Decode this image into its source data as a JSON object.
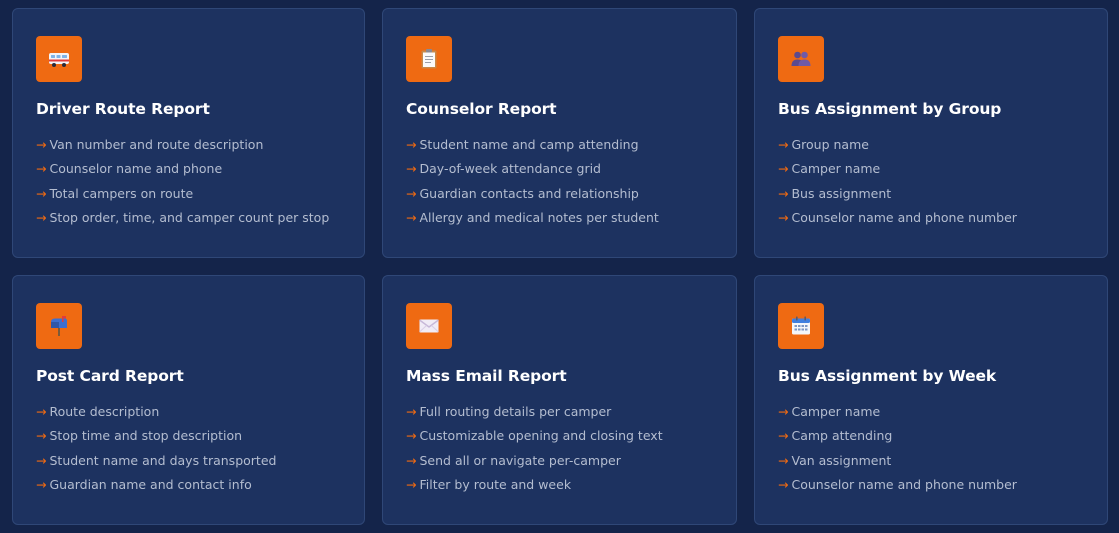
{
  "colors": {
    "background": "#14244a",
    "card": "#1d3260",
    "accent": "#ef6a12",
    "title": "#ffffff",
    "text": "#b4bdd0"
  },
  "arrow": "→",
  "cards": [
    {
      "icon": "van-icon",
      "title": "Driver Route Report",
      "features": [
        "Van number and route description",
        "Counselor name and phone",
        "Total campers on route",
        "Stop order, time, and camper count per stop"
      ]
    },
    {
      "icon": "clipboard-icon",
      "title": "Counselor Report",
      "features": [
        "Student name and camp attending",
        "Day-of-week attendance grid",
        "Guardian contacts and relationship",
        "Allergy and medical notes per student"
      ]
    },
    {
      "icon": "people-icon",
      "title": "Bus Assignment by Group",
      "features": [
        "Group name",
        "Camper name",
        "Bus assignment",
        "Counselor name and phone number"
      ]
    },
    {
      "icon": "mailbox-icon",
      "title": "Post Card Report",
      "features": [
        "Route description",
        "Stop time and stop description",
        "Student name and days transported",
        "Guardian name and contact info"
      ]
    },
    {
      "icon": "envelope-icon",
      "title": "Mass Email Report",
      "features": [
        "Full routing details per camper",
        "Customizable opening and closing text",
        "Send all or navigate per-camper",
        "Filter by route and week"
      ]
    },
    {
      "icon": "calendar-icon",
      "title": "Bus Assignment by Week",
      "features": [
        "Camper name",
        "Camp attending",
        "Van assignment",
        "Counselor name and phone number"
      ]
    }
  ]
}
